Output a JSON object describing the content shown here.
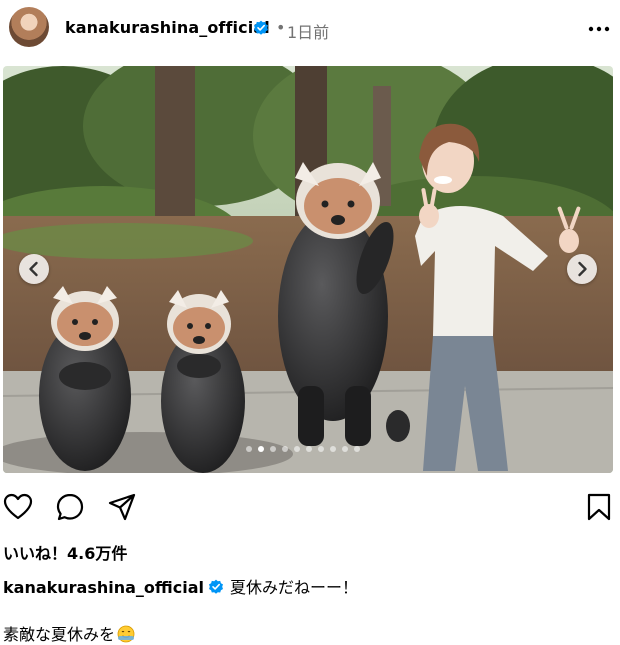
{
  "post": {
    "username": "kanakurashina_official",
    "separator": "•",
    "time_ago": "1日前",
    "likes_text": "いいね！4.6万件",
    "caption_main": "夏休みだねーー！",
    "caption_second": "素敵な夏休みを",
    "carousel": {
      "total_slides": 10,
      "active_index": 1
    }
  },
  "icons": {
    "verified": "verified-badge-icon",
    "more": "more-options-icon",
    "prev": "chevron-left-icon",
    "next": "chevron-right-icon",
    "like": "heart-icon",
    "comment": "comment-icon",
    "share": "send-icon",
    "save": "bookmark-icon",
    "emoji": "smiling-face-emoji"
  },
  "colors": {
    "verified_blue": "#0095f6",
    "secondary_text": "#737373"
  }
}
